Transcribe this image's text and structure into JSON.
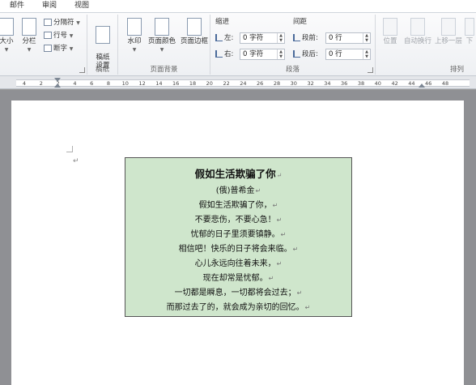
{
  "tabs": [
    "邮件",
    "审阅",
    "视图"
  ],
  "ribbon": {
    "page_setup": {
      "size_label": "大小",
      "columns_label": "分栏",
      "breaks_label": "分隔符",
      "line_numbers_label": "行号",
      "hyphenation_label": "断字"
    },
    "draft": {
      "button_label": "稿纸\n设置",
      "group_label": "稿纸"
    },
    "page_background": {
      "watermark_label": "水印",
      "page_color_label": "页面颜色",
      "page_borders_label": "页面边框",
      "group_label": "页面背景"
    },
    "paragraph": {
      "indent_header": "缩进",
      "spacing_header": "间距",
      "left_label": "左:",
      "right_label": "右:",
      "before_label": "段前:",
      "after_label": "段后:",
      "indent_left_value": "0 字符",
      "indent_right_value": "0 字符",
      "spacing_before_value": "0 行",
      "spacing_after_value": "0 行",
      "group_label": "段落"
    },
    "arrange": {
      "position_label": "位置",
      "wrap_label": "自动换行",
      "bring_forward_label": "上移一层",
      "send_backward_label": "下",
      "group_label": "排列"
    }
  },
  "ruler": {
    "numbers": [
      "4",
      "2",
      "2",
      "4",
      "6",
      "8",
      "10",
      "12",
      "14",
      "16",
      "18",
      "20",
      "22",
      "24",
      "26",
      "28",
      "30",
      "32",
      "34",
      "36",
      "38",
      "40",
      "42",
      "44",
      "46",
      "48"
    ]
  },
  "document": {
    "paragraph_mark": "↵",
    "title": "假如生活欺骗了你",
    "lines": [
      "(俄)普希金",
      "假如生活欺骗了你，",
      "不要悲伤，不要心急！",
      "忧郁的日子里须要镇静。",
      "相信吧！快乐的日子将会来临。",
      "心儿永远向往着未来，",
      "现在却常是忧郁。",
      "一切都是瞬息，一切都将会过去；",
      "而那过去了的，就会成为亲切的回忆。"
    ]
  },
  "colors": {
    "text_box_fill": "#cfe6cc",
    "page_background": "#ffffff",
    "workspace": "#8f9094"
  }
}
